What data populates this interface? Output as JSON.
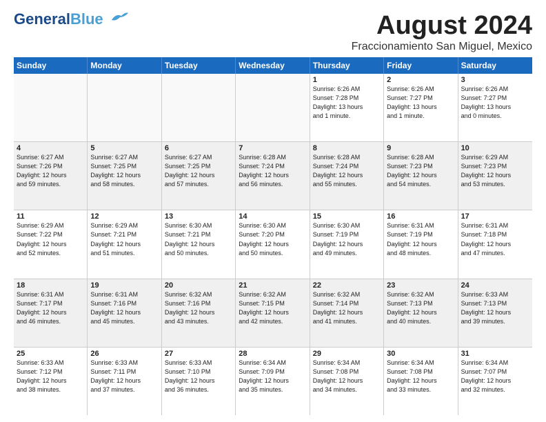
{
  "header": {
    "logo_line1": "General",
    "logo_line2": "Blue",
    "main_title": "August 2024",
    "subtitle": "Fraccionamiento San Miguel, Mexico"
  },
  "days_of_week": [
    "Sunday",
    "Monday",
    "Tuesday",
    "Wednesday",
    "Thursday",
    "Friday",
    "Saturday"
  ],
  "weeks": [
    [
      {
        "day": "",
        "info": "",
        "empty": true
      },
      {
        "day": "",
        "info": "",
        "empty": true
      },
      {
        "day": "",
        "info": "",
        "empty": true
      },
      {
        "day": "",
        "info": "",
        "empty": true
      },
      {
        "day": "1",
        "info": "Sunrise: 6:26 AM\nSunset: 7:28 PM\nDaylight: 13 hours\nand 1 minute.",
        "empty": false
      },
      {
        "day": "2",
        "info": "Sunrise: 6:26 AM\nSunset: 7:27 PM\nDaylight: 13 hours\nand 1 minute.",
        "empty": false
      },
      {
        "day": "3",
        "info": "Sunrise: 6:26 AM\nSunset: 7:27 PM\nDaylight: 13 hours\nand 0 minutes.",
        "empty": false
      }
    ],
    [
      {
        "day": "4",
        "info": "Sunrise: 6:27 AM\nSunset: 7:26 PM\nDaylight: 12 hours\nand 59 minutes.",
        "empty": false
      },
      {
        "day": "5",
        "info": "Sunrise: 6:27 AM\nSunset: 7:25 PM\nDaylight: 12 hours\nand 58 minutes.",
        "empty": false
      },
      {
        "day": "6",
        "info": "Sunrise: 6:27 AM\nSunset: 7:25 PM\nDaylight: 12 hours\nand 57 minutes.",
        "empty": false
      },
      {
        "day": "7",
        "info": "Sunrise: 6:28 AM\nSunset: 7:24 PM\nDaylight: 12 hours\nand 56 minutes.",
        "empty": false
      },
      {
        "day": "8",
        "info": "Sunrise: 6:28 AM\nSunset: 7:24 PM\nDaylight: 12 hours\nand 55 minutes.",
        "empty": false
      },
      {
        "day": "9",
        "info": "Sunrise: 6:28 AM\nSunset: 7:23 PM\nDaylight: 12 hours\nand 54 minutes.",
        "empty": false
      },
      {
        "day": "10",
        "info": "Sunrise: 6:29 AM\nSunset: 7:23 PM\nDaylight: 12 hours\nand 53 minutes.",
        "empty": false
      }
    ],
    [
      {
        "day": "11",
        "info": "Sunrise: 6:29 AM\nSunset: 7:22 PM\nDaylight: 12 hours\nand 52 minutes.",
        "empty": false
      },
      {
        "day": "12",
        "info": "Sunrise: 6:29 AM\nSunset: 7:21 PM\nDaylight: 12 hours\nand 51 minutes.",
        "empty": false
      },
      {
        "day": "13",
        "info": "Sunrise: 6:30 AM\nSunset: 7:21 PM\nDaylight: 12 hours\nand 50 minutes.",
        "empty": false
      },
      {
        "day": "14",
        "info": "Sunrise: 6:30 AM\nSunset: 7:20 PM\nDaylight: 12 hours\nand 50 minutes.",
        "empty": false
      },
      {
        "day": "15",
        "info": "Sunrise: 6:30 AM\nSunset: 7:19 PM\nDaylight: 12 hours\nand 49 minutes.",
        "empty": false
      },
      {
        "day": "16",
        "info": "Sunrise: 6:31 AM\nSunset: 7:19 PM\nDaylight: 12 hours\nand 48 minutes.",
        "empty": false
      },
      {
        "day": "17",
        "info": "Sunrise: 6:31 AM\nSunset: 7:18 PM\nDaylight: 12 hours\nand 47 minutes.",
        "empty": false
      }
    ],
    [
      {
        "day": "18",
        "info": "Sunrise: 6:31 AM\nSunset: 7:17 PM\nDaylight: 12 hours\nand 46 minutes.",
        "empty": false
      },
      {
        "day": "19",
        "info": "Sunrise: 6:31 AM\nSunset: 7:16 PM\nDaylight: 12 hours\nand 45 minutes.",
        "empty": false
      },
      {
        "day": "20",
        "info": "Sunrise: 6:32 AM\nSunset: 7:16 PM\nDaylight: 12 hours\nand 43 minutes.",
        "empty": false
      },
      {
        "day": "21",
        "info": "Sunrise: 6:32 AM\nSunset: 7:15 PM\nDaylight: 12 hours\nand 42 minutes.",
        "empty": false
      },
      {
        "day": "22",
        "info": "Sunrise: 6:32 AM\nSunset: 7:14 PM\nDaylight: 12 hours\nand 41 minutes.",
        "empty": false
      },
      {
        "day": "23",
        "info": "Sunrise: 6:32 AM\nSunset: 7:13 PM\nDaylight: 12 hours\nand 40 minutes.",
        "empty": false
      },
      {
        "day": "24",
        "info": "Sunrise: 6:33 AM\nSunset: 7:13 PM\nDaylight: 12 hours\nand 39 minutes.",
        "empty": false
      }
    ],
    [
      {
        "day": "25",
        "info": "Sunrise: 6:33 AM\nSunset: 7:12 PM\nDaylight: 12 hours\nand 38 minutes.",
        "empty": false
      },
      {
        "day": "26",
        "info": "Sunrise: 6:33 AM\nSunset: 7:11 PM\nDaylight: 12 hours\nand 37 minutes.",
        "empty": false
      },
      {
        "day": "27",
        "info": "Sunrise: 6:33 AM\nSunset: 7:10 PM\nDaylight: 12 hours\nand 36 minutes.",
        "empty": false
      },
      {
        "day": "28",
        "info": "Sunrise: 6:34 AM\nSunset: 7:09 PM\nDaylight: 12 hours\nand 35 minutes.",
        "empty": false
      },
      {
        "day": "29",
        "info": "Sunrise: 6:34 AM\nSunset: 7:08 PM\nDaylight: 12 hours\nand 34 minutes.",
        "empty": false
      },
      {
        "day": "30",
        "info": "Sunrise: 6:34 AM\nSunset: 7:08 PM\nDaylight: 12 hours\nand 33 minutes.",
        "empty": false
      },
      {
        "day": "31",
        "info": "Sunrise: 6:34 AM\nSunset: 7:07 PM\nDaylight: 12 hours\nand 32 minutes.",
        "empty": false
      }
    ]
  ]
}
